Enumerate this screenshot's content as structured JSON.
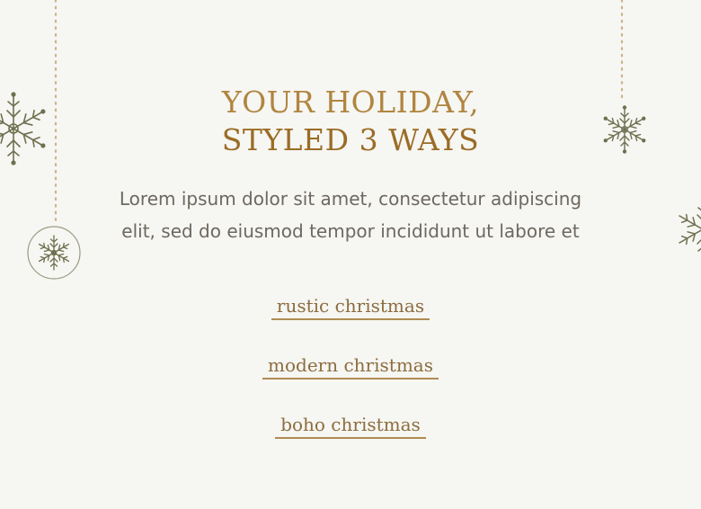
{
  "colors": {
    "background": "#f6f6f2",
    "headline": "#a87b33",
    "body_text": "#6d6860",
    "link_text": "#8c6d3f",
    "link_underline": "#b08c52",
    "ornament": "#6f7050",
    "string": "#c9b48c"
  },
  "hero": {
    "headline_line1": "YOUR HOLIDAY,",
    "headline_line2": "STYLED 3 WAYS",
    "body_line1": "Lorem ipsum dolor sit amet, consectetur adipiscing",
    "body_line2": "elit, sed do eiusmod tempor incididunt ut labore et"
  },
  "styles": [
    {
      "label": "rustic christmas"
    },
    {
      "label": "modern christmas"
    },
    {
      "label": "boho christmas"
    }
  ],
  "ornaments": {
    "left_snowflake": "snowflake-icon",
    "left_bauble": "snowflake-bauble-icon",
    "right_snowflake": "snowflake-icon",
    "right_edge_snowflake": "snowflake-icon"
  }
}
